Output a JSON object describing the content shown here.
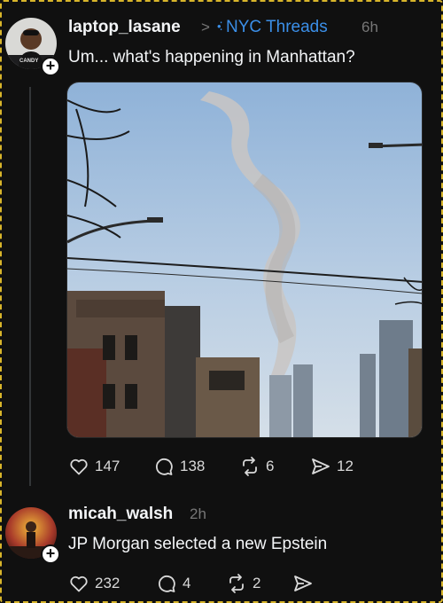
{
  "post": {
    "username": "laptop_lasane",
    "separator": ">",
    "community": "NYC Threads",
    "time": "6h",
    "text": "Um... what's happening in Manhattan?",
    "avatar_caption": "CANDY",
    "actions": {
      "likes": "147",
      "replies": "138",
      "reposts": "6",
      "shares": "12"
    }
  },
  "reply": {
    "username": "micah_walsh",
    "time": "2h",
    "text": "JP Morgan selected a new Epstein",
    "actions": {
      "likes": "232",
      "replies": "4",
      "reposts": "2"
    }
  },
  "colors": {
    "background": "#101010",
    "accent_link": "#3b8fe8",
    "highlight_border": "#d8b52a"
  }
}
